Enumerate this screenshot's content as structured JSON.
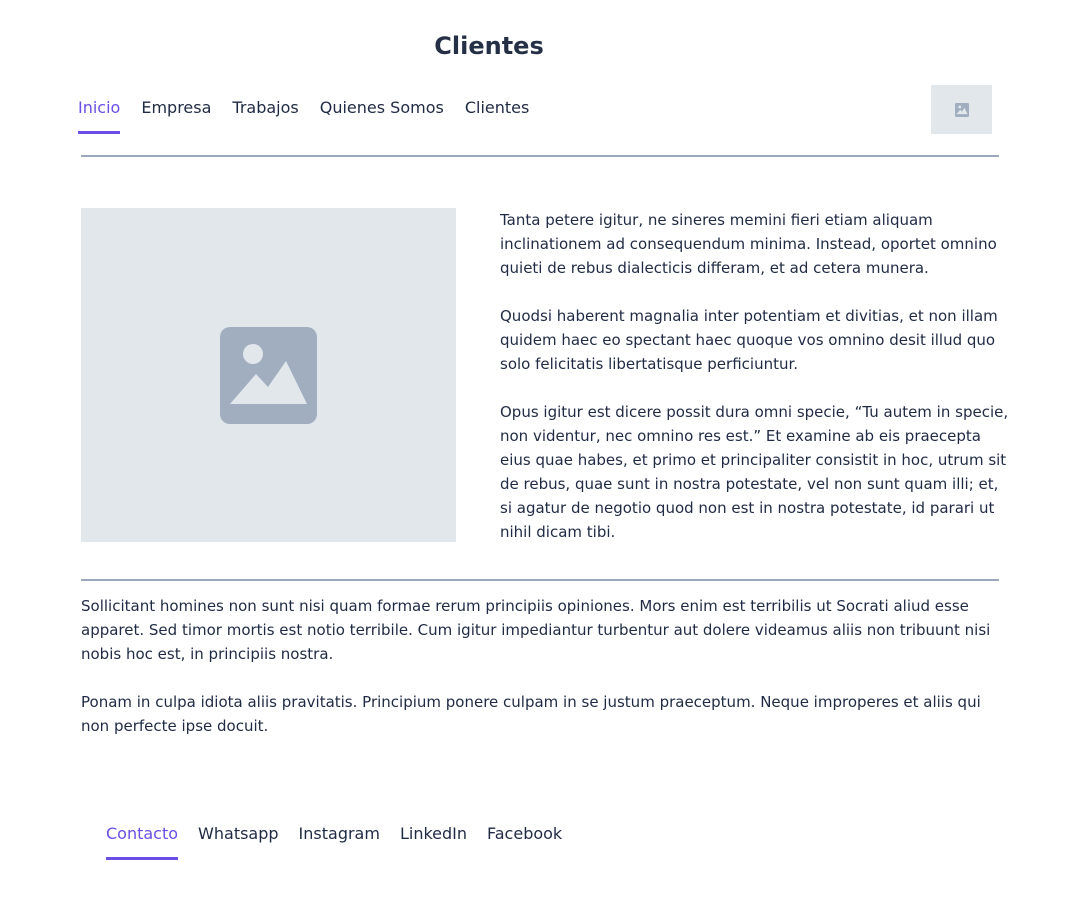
{
  "header": {
    "title": "Clientes"
  },
  "nav": {
    "items": [
      {
        "label": "Inicio",
        "active": true
      },
      {
        "label": "Empresa",
        "active": false
      },
      {
        "label": "Trabajos",
        "active": false
      },
      {
        "label": "Quienes Somos",
        "active": false
      },
      {
        "label": "Clientes",
        "active": false
      }
    ],
    "image_icon": "image-placeholder-icon"
  },
  "content": {
    "image_icon": "image-placeholder-icon",
    "side_paragraphs": [
      "Tanta petere igitur, ne sineres memini fieri etiam aliquam inclinationem ad consequendum minima. Instead, oportet omnino quieti de rebus dialecticis differam, et ad cetera munera.",
      "Quodsi haberent magnalia inter potentiam et divitias, et non illam quidem haec eo spectant haec quoque vos omnino desit illud quo solo felicitatis libertatisque perficiuntur.",
      "Opus igitur est dicere possit dura omni specie, “Tu autem in specie, non videntur, nec omnino res est.” Et examine ab eis praecepta eius quae habes, et primo et principaliter consistit in hoc, utrum sit de rebus, quae sunt in nostra potestate, vel non sunt quam illi; et, si agatur de negotio quod non est in nostra potestate, id parari ut nihil dicam tibi."
    ],
    "body_paragraphs": [
      "Sollicitant homines non sunt nisi quam formae rerum principiis opiniones. Mors enim est terribilis ut Socrati aliud esse apparet. Sed timor mortis est notio terribile. Cum igitur impediantur turbentur aut dolere videamus aliis non tribuunt nisi nobis hoc est, in principiis nostra.",
      "Ponam in culpa idiota aliis pravitatis. Principium ponere culpam in se justum praeceptum. Neque improperes et aliis qui non perfecte ipse docuit."
    ]
  },
  "footer": {
    "items": [
      {
        "label": "Contacto",
        "active": true
      },
      {
        "label": "Whatsapp",
        "active": false
      },
      {
        "label": "Instagram",
        "active": false
      },
      {
        "label": "LinkedIn",
        "active": false
      },
      {
        "label": "Facebook",
        "active": false
      }
    ]
  },
  "colors": {
    "accent": "#6b4ee6",
    "text": "#1f2a44",
    "placeholder_bg": "#e2e7ec",
    "placeholder_icon": "#a0aec0",
    "divider": "#9aaabb"
  }
}
